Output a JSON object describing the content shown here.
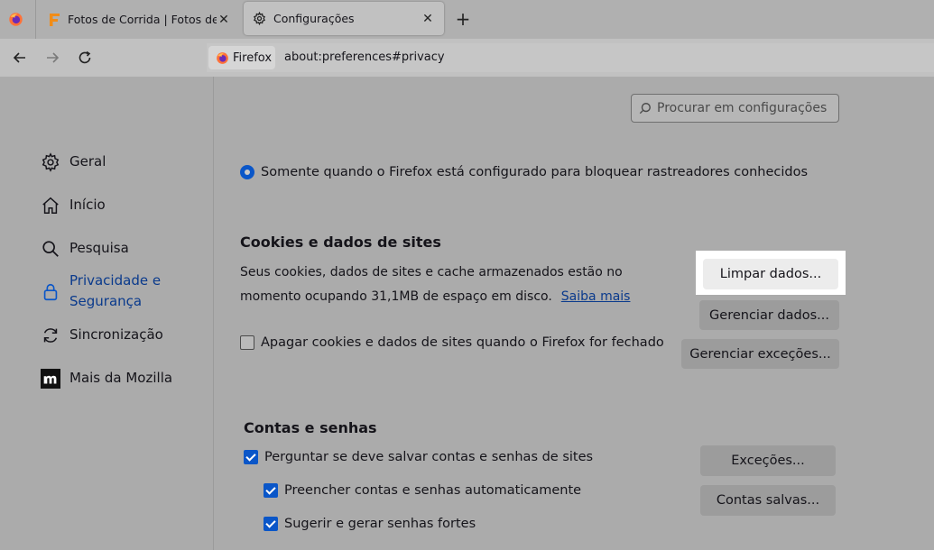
{
  "tabs": [
    {
      "label": "Fotos de Corrida | Fotos de Maratona",
      "icon": "fotos-f-icon"
    },
    {
      "label": "Configurações",
      "icon": "gear-icon",
      "active": true
    }
  ],
  "new_tab_label": "+",
  "tab_close_label": "✕",
  "urlbar": {
    "identity_label": "Firefox",
    "url": "about:preferences#privacy"
  },
  "sidebar": {
    "items": [
      {
        "label": "Geral",
        "icon": "gear-icon"
      },
      {
        "label": "Início",
        "icon": "home-icon"
      },
      {
        "label": "Pesquisa",
        "icon": "search-icon"
      },
      {
        "label": "Privacidade e Segurança",
        "icon": "lock-icon",
        "active": true
      },
      {
        "label": "Sincronização",
        "icon": "sync-icon"
      },
      {
        "label": "Mais da Mozilla",
        "icon": "mozilla-icon"
      }
    ]
  },
  "main": {
    "search_placeholder": "Procurar em configurações",
    "tracking_option": "Somente quando o Firefox está configurado para bloquear rastreadores conhecidos",
    "cookies": {
      "heading": "Cookies e dados de sites",
      "description": "Seus cookies, dados de sites e cache armazenados estão no momento ocupando 31,1MB de espaço em disco.",
      "learn_more": "Saiba mais",
      "clear_button": "Limpar dados...",
      "manage_button": "Gerenciar dados...",
      "delete_on_close": "Apagar cookies e dados de sites quando o Firefox for fechado",
      "exceptions_button": "Gerenciar exceções..."
    },
    "logins": {
      "heading": "Contas e senhas",
      "ask_save": "Perguntar se deve salvar contas e senhas de sites",
      "autofill": "Preencher contas e senhas automaticamente",
      "suggest": "Sugerir e gerar senhas fortes",
      "exceptions_button": "Exceções...",
      "saved_button": "Contas salvas..."
    }
  },
  "colors": {
    "accent": "#0a56c8",
    "link": "#0a3a8c"
  }
}
